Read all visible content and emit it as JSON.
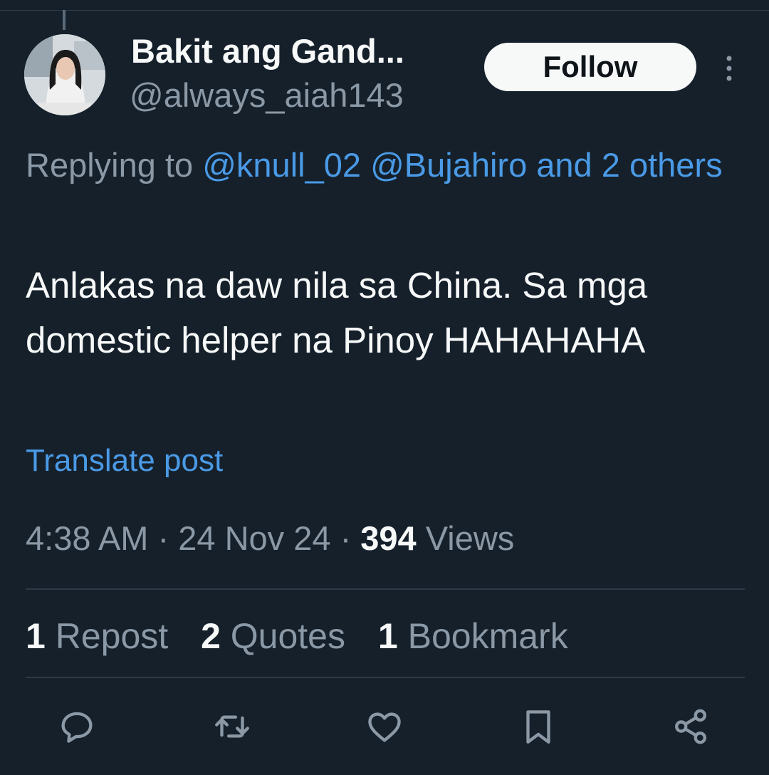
{
  "author": {
    "display_name": "Bakit ang Gand...",
    "handle": "@always_aiah143"
  },
  "follow_label": "Follow",
  "reply": {
    "prefix": "Replying to",
    "mention_1": "@knull_02",
    "mention_2": "@Bujahiro",
    "others": "and 2 others"
  },
  "post": {
    "text": "Anlakas na daw nila sa China. Sa mga domestic helper na Pinoy HAHAHAHA",
    "translate_label": "Translate post"
  },
  "meta": {
    "time": "4:38 AM",
    "date": "24 Nov 24",
    "views_count": "394",
    "views_label": "Views"
  },
  "stats": {
    "reposts_count": "1",
    "reposts_label": "Repost",
    "quotes_count": "2",
    "quotes_label": "Quotes",
    "bookmarks_count": "1",
    "bookmarks_label": "Bookmark"
  },
  "icons": {
    "reply": "reply-icon",
    "repost": "repost-icon",
    "like": "heart-icon",
    "bookmark": "bookmark-icon",
    "share": "share-icon",
    "more": "more-icon"
  },
  "colors": {
    "background": "#15202b",
    "link": "#4a9ae6",
    "muted": "#8b98a5",
    "text": "#f7f9f9"
  }
}
